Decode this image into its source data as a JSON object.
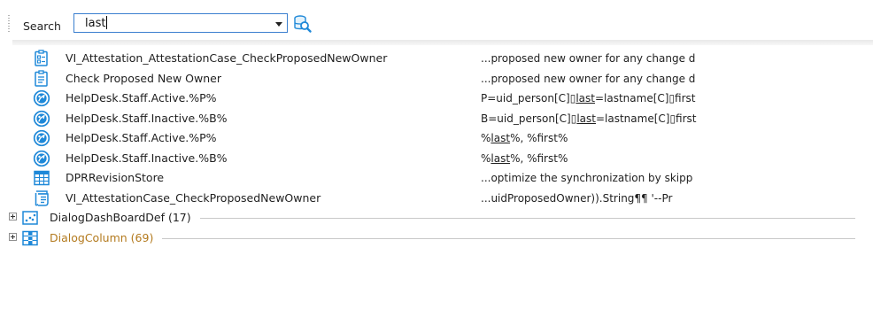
{
  "search": {
    "label": "Search",
    "value": "last"
  },
  "results": [
    {
      "icon": "form-icon",
      "name": "VI_Attestation_AttestationCase_CheckProposedNewOwner",
      "snippet": [
        {
          "t": "...proposed new owner for any change d"
        }
      ]
    },
    {
      "icon": "clipboard-icon",
      "name": "Check Proposed New Owner",
      "snippet": [
        {
          "t": "...proposed new owner for any change d"
        }
      ]
    },
    {
      "icon": "helpdesk-icon",
      "name": "HelpDesk.Staff.Active.%P%",
      "snippet": [
        {
          "t": "P=uid_person[C]▯"
        },
        {
          "t": "last",
          "hl": true
        },
        {
          "t": "=lastname[C]▯first"
        }
      ]
    },
    {
      "icon": "helpdesk-icon",
      "name": "HelpDesk.Staff.Inactive.%B%",
      "snippet": [
        {
          "t": "B=uid_person[C]▯"
        },
        {
          "t": "last",
          "hl": true
        },
        {
          "t": "=lastname[C]▯first"
        }
      ]
    },
    {
      "icon": "helpdesk-icon",
      "name": "HelpDesk.Staff.Active.%P%",
      "snippet": [
        {
          "t": "%"
        },
        {
          "t": "last",
          "hl": true
        },
        {
          "t": "%, %first%"
        }
      ]
    },
    {
      "icon": "helpdesk-icon",
      "name": "HelpDesk.Staff.Inactive.%B%",
      "snippet": [
        {
          "t": "%"
        },
        {
          "t": "last",
          "hl": true
        },
        {
          "t": "%, %first%"
        }
      ]
    },
    {
      "icon": "table-icon",
      "name": "DPRRevisionStore",
      "snippet": [
        {
          "t": "...optimize the synchronization by skipp"
        }
      ]
    },
    {
      "icon": "script-icon",
      "name": "VI_AttestationCase_CheckProposedNewOwner",
      "snippet": [
        {
          "t": "...uidProposedOwner)).String¶¶        '--Pr"
        }
      ]
    }
  ],
  "groups": [
    {
      "icon": "dashboard-icon",
      "title": "DialogDashBoardDef (17)",
      "color": "#1f1f1f"
    },
    {
      "icon": "column-table-icon",
      "title": "DialogColumn (69)",
      "color": "#b37a1e"
    }
  ],
  "colors": {
    "accent": "#1e88d8",
    "group_highlight": "#b37a1e",
    "combo_border": "#3b7fcf"
  }
}
